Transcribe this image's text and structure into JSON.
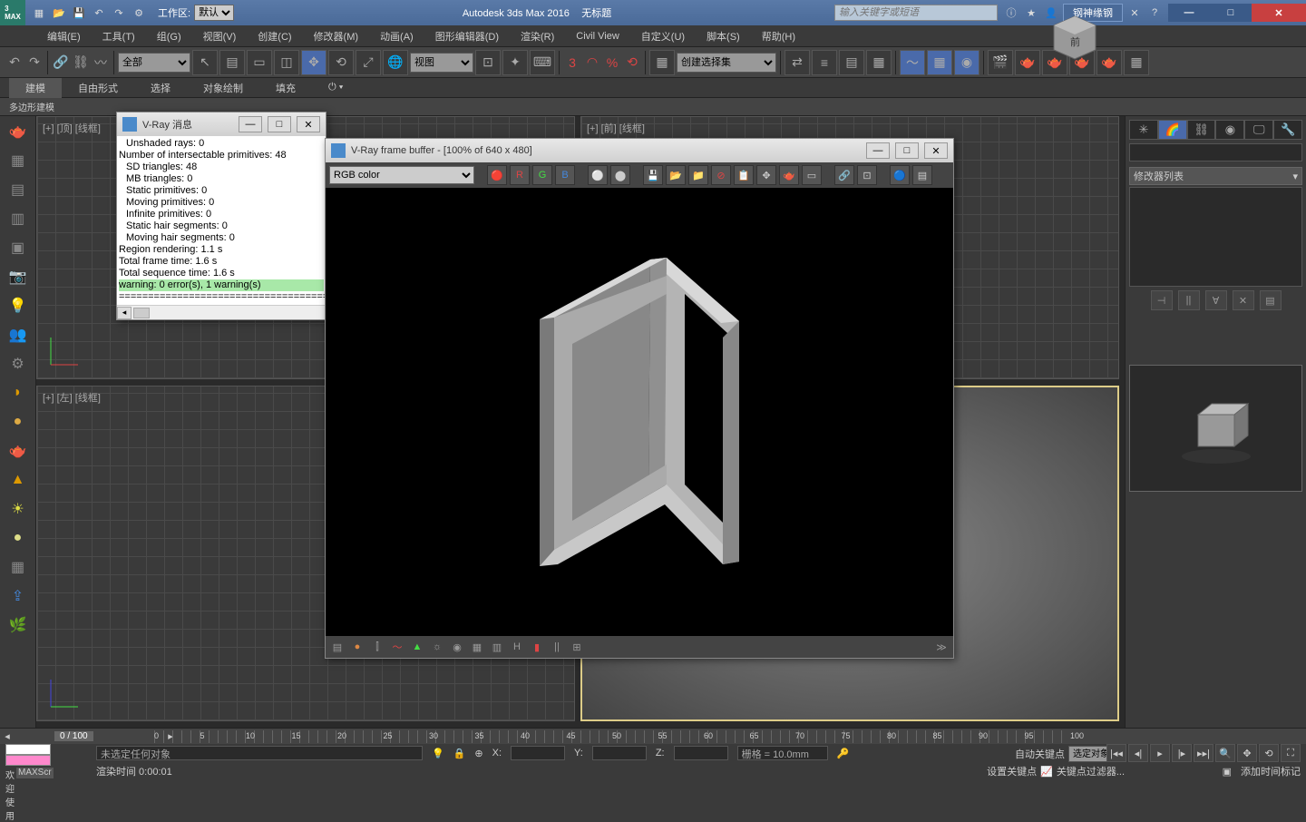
{
  "title": {
    "app": "Autodesk 3ds Max 2016",
    "doc": "无标题",
    "workspace_label": "工作区:",
    "workspace_value": "默认",
    "search_placeholder": "输入关键字或短语",
    "user": "钢神缘钢"
  },
  "menu": [
    "编辑(E)",
    "工具(T)",
    "组(G)",
    "视图(V)",
    "创建(C)",
    "修改器(M)",
    "动画(A)",
    "图形编辑器(D)",
    "渲染(R)",
    "Civil View",
    "自定义(U)",
    "脚本(S)",
    "帮助(H)"
  ],
  "maintb": {
    "filter": "全部",
    "viewsel": "视图",
    "selset": "创建选择集"
  },
  "ribbon": {
    "tabs": [
      "建模",
      "自由形式",
      "选择",
      "对象绘制",
      "填充"
    ],
    "sub": "多边形建模"
  },
  "viewports": {
    "top": "[+] [顶] [线框]",
    "front": "[+] [前] [线框]",
    "left": "[+] [左] [线框]"
  },
  "rpanel": {
    "modlist": "修改器列表"
  },
  "vraymsg": {
    "title": "V-Ray 消息",
    "lines": [
      "Unshaded rays: 0",
      "Number of intersectable primitives: 48",
      "SD triangles: 48",
      "MB triangles: 0",
      "Static primitives: 0",
      "Moving primitives: 0",
      "Infinite primitives: 0",
      "Static hair segments: 0",
      "Moving hair segments: 0"
    ],
    "reg": "Region rendering: 1.1 s",
    "tft": "Total frame time: 1.6 s",
    "tst": "Total sequence time: 1.6 s",
    "warn": "warning: 0 error(s), 1 warning(s)",
    "sep": "========================================="
  },
  "vfb": {
    "title": "V-Ray frame buffer - [100% of 640 x 480]",
    "channel": "RGB color"
  },
  "status": {
    "nosel": "未选定任何对象",
    "x": "X:",
    "y": "Y:",
    "z": "Z:",
    "grid": "栅格 = 10.0mm",
    "autokey": "自动关键点",
    "selobj": "选定对象",
    "setkey": "设置关键点",
    "keyfilter": "关键点过滤器...",
    "welcome": "欢迎使用",
    "script": "MAXScr",
    "rendertime": "渲染时间 0:00:01",
    "addtime": "添加时间标记",
    "frame": "0 / 100"
  },
  "ticks": [
    "0",
    "5",
    "10",
    "15",
    "20",
    "25",
    "30",
    "35",
    "40",
    "45",
    "50",
    "55",
    "60",
    "65",
    "70",
    "75",
    "80",
    "85",
    "90",
    "95",
    "100"
  ]
}
